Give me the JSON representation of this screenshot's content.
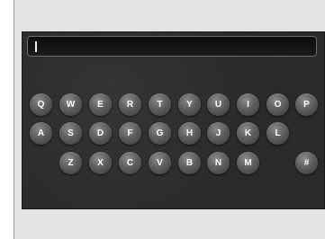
{
  "keyboard": {
    "row1": [
      "Q",
      "W",
      "E",
      "R",
      "T",
      "Y",
      "U",
      "I",
      "O",
      "P"
    ],
    "row2": [
      "A",
      "S",
      "D",
      "F",
      "G",
      "H",
      "J",
      "K",
      "L"
    ],
    "row3": [
      "Z",
      "X",
      "C",
      "V",
      "B",
      "N",
      "M"
    ],
    "symbol_key": "#"
  },
  "text_input": {
    "value": ""
  }
}
